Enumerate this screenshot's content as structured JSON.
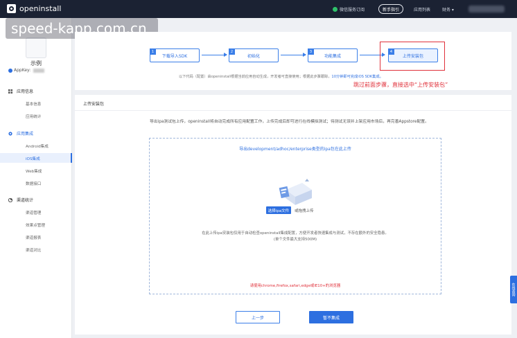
{
  "topbar": {
    "logo_text": "openinstall",
    "wechat_label": "微信服务订阅",
    "guide_label": "新手指引",
    "apps_label": "应用列表",
    "finance_label": "财务 ▾"
  },
  "watermark": "speed-kapp.com.cn",
  "sidebar": {
    "app_name": "示例",
    "appkey_label": "AppKey:",
    "sections": [
      {
        "label": "应用信息",
        "icon": "grid-icon",
        "items": [
          "基本信息",
          "应用统计"
        ]
      },
      {
        "label": "应用集成",
        "icon": "gear-icon",
        "items": [
          "Android集成",
          "iOS集成",
          "Web集成",
          "数据接口"
        ]
      },
      {
        "label": "渠道统计",
        "icon": "chart-icon",
        "items": [
          "渠道管理",
          "效果点管理",
          "渠道报表",
          "渠道对比"
        ]
      }
    ],
    "active_item": "iOS集成"
  },
  "steps": {
    "items": [
      {
        "num": "1",
        "label": "下载导入SDK"
      },
      {
        "num": "2",
        "label": "初始化"
      },
      {
        "num": "3",
        "label": "功能集成"
      },
      {
        "num": "4",
        "label": "上传安装包"
      }
    ],
    "note_prefix": "以下代码（配置）由openinstall根据当前应用自动生成，开发者可直接使用；根据此步骤跟踪，",
    "note_link": "10分钟即可完成iOS SDK集成。",
    "red_note": "跳过前面步骤，直接选中“上传安装包”"
  },
  "upload": {
    "title": "上传安装包",
    "description": "导出ipa测试包上传，openinstall将自动完成所有应用配置工作，上传完成后即可进行在线模拟测试；待测试无误并上架应用市场后，再完善Appstore配置。",
    "dropzone_title": "导出development/adhoc/enterprise类型的ipa包在此上传",
    "select_button": "选择ipa文件",
    "drag_text": "或拖拽上传",
    "note_line1": "在此上传ipa安装包仅用于自动检查openinstall集成配置，方便开发者快速集成与测试，不存在额外的安全隐患。",
    "note_line2": "(单个文件最大支持500M)",
    "browser_note": "请使用chrome,firefox,safari,edge或IE10+的浏览器",
    "prev_button": "上一步",
    "skip_button": "暂不集成"
  },
  "side_tab": "在线咨询"
}
